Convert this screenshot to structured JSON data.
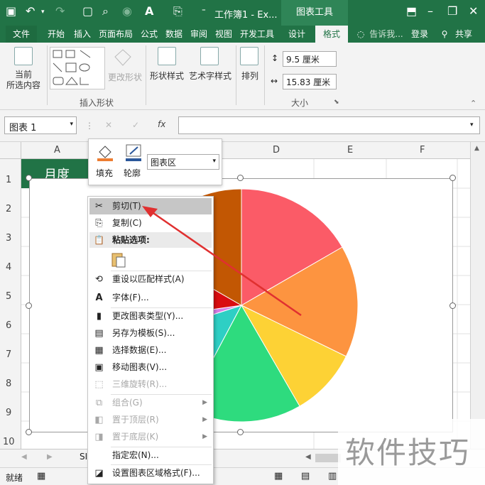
{
  "titlebar": {
    "doc_title": "工作簿1 - Ex...",
    "context_header": "图表工具"
  },
  "tabs": [
    {
      "label": "文件"
    },
    {
      "label": "开始"
    },
    {
      "label": "插入"
    },
    {
      "label": "页面布局"
    },
    {
      "label": "公式"
    },
    {
      "label": "数据"
    },
    {
      "label": "审阅"
    },
    {
      "label": "视图"
    },
    {
      "label": "开发工具"
    },
    {
      "label": "设计"
    },
    {
      "label": "格式"
    }
  ],
  "tell_me": "告诉我...",
  "login": "登录",
  "share": "共享",
  "ribbon": {
    "current_selection": "当前\n所选内容",
    "current_selection_line1": "当前",
    "current_selection_line2": "所选内容",
    "change_shape": "更改形状",
    "insert_shapes_group": "插入形状",
    "shape_styles": "形状样式",
    "wordart_styles": "艺术字样式",
    "arrange": "排列",
    "height_value": "9.5 厘米",
    "width_value": "15.83 厘米",
    "size_group": "大小"
  },
  "formula": {
    "namebox": "图表 1",
    "fx": "fx",
    "value": ""
  },
  "columns": [
    "A",
    "B",
    "C",
    "D",
    "E",
    "F"
  ],
  "rows": [
    "1",
    "2",
    "3",
    "4",
    "5",
    "6",
    "7",
    "8",
    "9",
    "10"
  ],
  "cell_a1": "月度",
  "minitoolbar": {
    "fill": "填充",
    "outline": "轮廓",
    "element_select": "图表区"
  },
  "contextmenu": {
    "cut": "剪切(T)",
    "copy": "复制(C)",
    "paste_options": "粘贴选项:",
    "reset_style": "重设以匹配样式(A)",
    "font": "字体(F)...",
    "change_chart_type": "更改图表类型(Y)...",
    "save_as_template": "另存为模板(S)...",
    "select_data": "选择数据(E)...",
    "move_chart": "移动图表(V)...",
    "rotate_3d": "三维旋转(R)...",
    "group": "组合(G)",
    "bring_to_front": "置于顶层(R)",
    "send_to_back": "置于底层(K)",
    "assign_macro": "指定宏(N)...",
    "format_chart_area": "设置图表区域格式(F)..."
  },
  "sheet_tab_partial": "SI",
  "status": {
    "ready": "就绪"
  },
  "watermark": "软件技巧",
  "pie_colors": [
    "#fb5b67",
    "#fd9440",
    "#fdd235",
    "#2edb7e",
    "#2ecfc4",
    "#d87ce6",
    "#d90c10",
    "#c25703"
  ]
}
